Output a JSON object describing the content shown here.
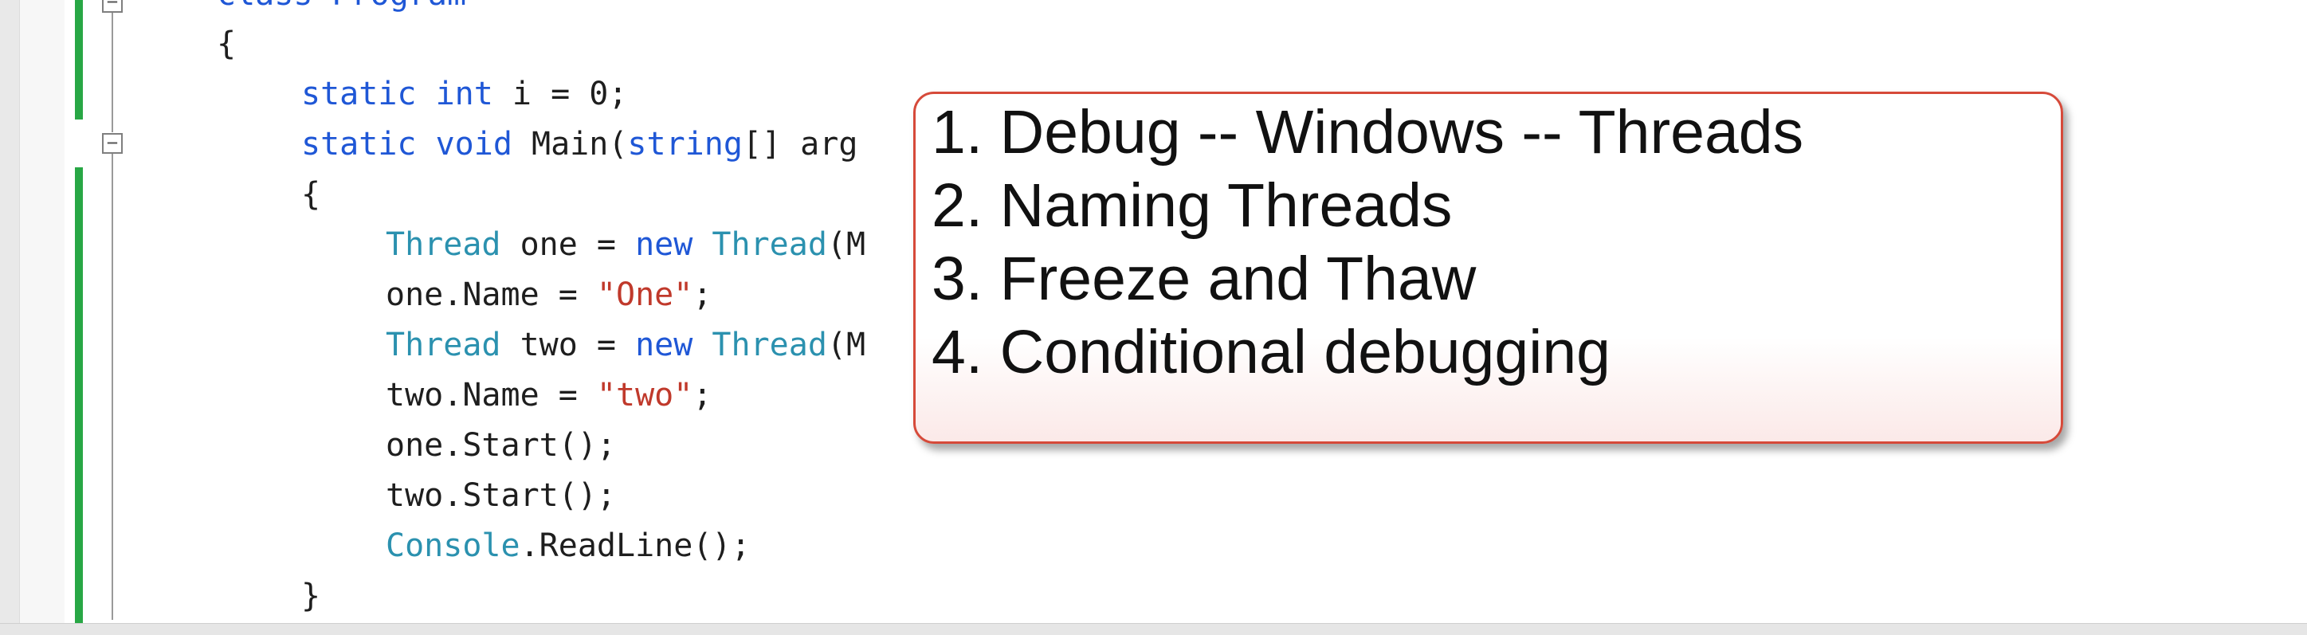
{
  "editor": {
    "partial_top_line": "class Program",
    "lines": [
      {
        "indent": 0,
        "tokens": [
          {
            "t": "{",
            "c": "plain"
          }
        ]
      },
      {
        "indent": 1,
        "tokens": [
          {
            "t": "static",
            "c": "kw"
          },
          {
            "t": " ",
            "c": "plain"
          },
          {
            "t": "int",
            "c": "kw"
          },
          {
            "t": " i = 0;",
            "c": "plain"
          }
        ]
      },
      {
        "indent": 1,
        "tokens": [
          {
            "t": "static",
            "c": "kw"
          },
          {
            "t": " ",
            "c": "plain"
          },
          {
            "t": "void",
            "c": "kw"
          },
          {
            "t": " Main(",
            "c": "plain"
          },
          {
            "t": "string",
            "c": "kw"
          },
          {
            "t": "[] arg",
            "c": "plain"
          }
        ]
      },
      {
        "indent": 1,
        "tokens": [
          {
            "t": "{",
            "c": "plain"
          }
        ]
      },
      {
        "indent": 2,
        "tokens": [
          {
            "t": "Thread",
            "c": "ty"
          },
          {
            "t": " one = ",
            "c": "plain"
          },
          {
            "t": "new",
            "c": "kw"
          },
          {
            "t": " ",
            "c": "plain"
          },
          {
            "t": "Thread",
            "c": "ty"
          },
          {
            "t": "(M",
            "c": "plain"
          }
        ]
      },
      {
        "indent": 2,
        "tokens": [
          {
            "t": "one.Name = ",
            "c": "plain"
          },
          {
            "t": "\"One\"",
            "c": "str"
          },
          {
            "t": ";",
            "c": "plain"
          }
        ]
      },
      {
        "indent": 2,
        "tokens": [
          {
            "t": "Thread",
            "c": "ty"
          },
          {
            "t": " two = ",
            "c": "plain"
          },
          {
            "t": "new",
            "c": "kw"
          },
          {
            "t": " ",
            "c": "plain"
          },
          {
            "t": "Thread",
            "c": "ty"
          },
          {
            "t": "(M",
            "c": "plain"
          }
        ]
      },
      {
        "indent": 2,
        "tokens": [
          {
            "t": "two.Name = ",
            "c": "plain"
          },
          {
            "t": "\"two\"",
            "c": "str"
          },
          {
            "t": ";",
            "c": "plain"
          }
        ]
      },
      {
        "indent": 2,
        "tokens": [
          {
            "t": "one.Start();",
            "c": "plain"
          }
        ]
      },
      {
        "indent": 2,
        "tokens": [
          {
            "t": "two.Start();",
            "c": "plain"
          }
        ]
      },
      {
        "indent": 2,
        "tokens": [
          {
            "t": "Console",
            "c": "ty"
          },
          {
            "t": ".ReadLine();",
            "c": "plain"
          }
        ]
      },
      {
        "indent": 1,
        "tokens": [
          {
            "t": "}",
            "c": "plain"
          }
        ]
      }
    ]
  },
  "callout": {
    "items": [
      "1. Debug -- Windows -- Threads",
      "2. Naming Threads",
      "3. Freeze and Thaw",
      "4. Conditional debugging"
    ]
  },
  "colors": {
    "keyword": "#1f57d6",
    "type": "#2b91af",
    "string": "#c0392b",
    "change_bar": "#28a745",
    "callout_border": "#d64a3a"
  }
}
